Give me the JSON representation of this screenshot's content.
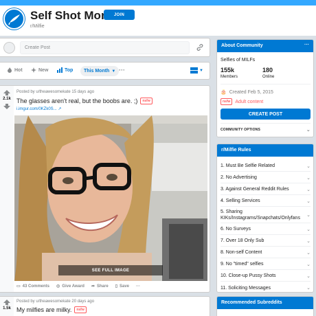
{
  "subreddit": {
    "title": "Self Shot Moms",
    "name": "r/Milfie",
    "join_label": "JOIN"
  },
  "create_post": {
    "placeholder": "Create Post"
  },
  "sort": {
    "hot": "Hot",
    "new": "New",
    "top": "Top",
    "time": "This Month",
    "more": "···"
  },
  "posts": [
    {
      "votes": "2.1k",
      "meta": "Posted by u/theawesomekate 15 days ago",
      "title": "The glasses aren't real, but the boobs are. ;)",
      "nsfw": "nsfw",
      "link": "i.imgur.com/0KZk0S...",
      "see_full": "SEE FULL IMAGE",
      "comments": "43 Comments",
      "award": "Give Award",
      "share": "Share",
      "save": "Save",
      "more": "···"
    },
    {
      "votes": "1.5k",
      "meta": "Posted by u/theawesomekate 20 days ago",
      "title": "My milfies are milky.",
      "nsfw": "nsfw"
    }
  ],
  "about": {
    "header": "About Community",
    "more": "···",
    "description": "Selfies of MILFs",
    "members_count": "155k",
    "members_label": "Members",
    "online_count": "180",
    "online_label": "Online",
    "created": "Created Feb 5, 2015",
    "nsfw_tag": "nsfw",
    "adult_label": "Adult content",
    "create_post_label": "CREATE POST",
    "community_options": "COMMUNITY OPTIONS"
  },
  "rules": {
    "header": "r/Milfie Rules",
    "items": [
      "1. Must Be Selfie Related",
      "2. No Advertising",
      "3. Against General Reddit Rules",
      "4. Selling Services",
      "5. Sharing KIKs/Instagrams/Snapchats/Onlyfans",
      "6. No Surveys",
      "7. Over 18 Only Sub",
      "8. Non-self Content",
      "9. No \"timed\" selfies",
      "10. Close-up Pussy Shots",
      "11. Soliciting Messages"
    ]
  },
  "recommended": {
    "header": "Recommended Subreddits"
  },
  "colors": {
    "accent": "#0079d3",
    "banner": "#33a8ff",
    "nsfw": "#ff585b",
    "background": "#dae0e6"
  },
  "icons": [
    "subreddit-icon",
    "link-icon",
    "hot-icon",
    "new-icon",
    "top-icon",
    "card-view-icon",
    "upvote-icon",
    "downvote-icon",
    "comment-icon",
    "award-icon",
    "share-icon",
    "save-icon",
    "cake-icon",
    "chevron-down-icon"
  ]
}
